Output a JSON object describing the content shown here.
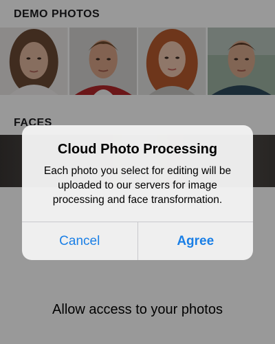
{
  "sections": {
    "demo_photos": "DEMO PHOTOS",
    "faces": "FACES"
  },
  "photos": [
    {
      "icon": "woman-portrait-photo"
    },
    {
      "icon": "man-portrait-photo"
    },
    {
      "icon": "woman-redhead-portrait-photo"
    },
    {
      "icon": "man-outdoor-portrait-photo"
    }
  ],
  "permission": {
    "text": "Allow access to your photos"
  },
  "alert": {
    "title": "Cloud Photo Processing",
    "message": "Each photo you select for editing will be uploaded to our servers for image processing and face transformation.",
    "cancel_label": "Cancel",
    "agree_label": "Agree"
  },
  "colors": {
    "accent": "#1a7fe6",
    "dim_overlay": "rgba(0,0,0,0.40)"
  }
}
